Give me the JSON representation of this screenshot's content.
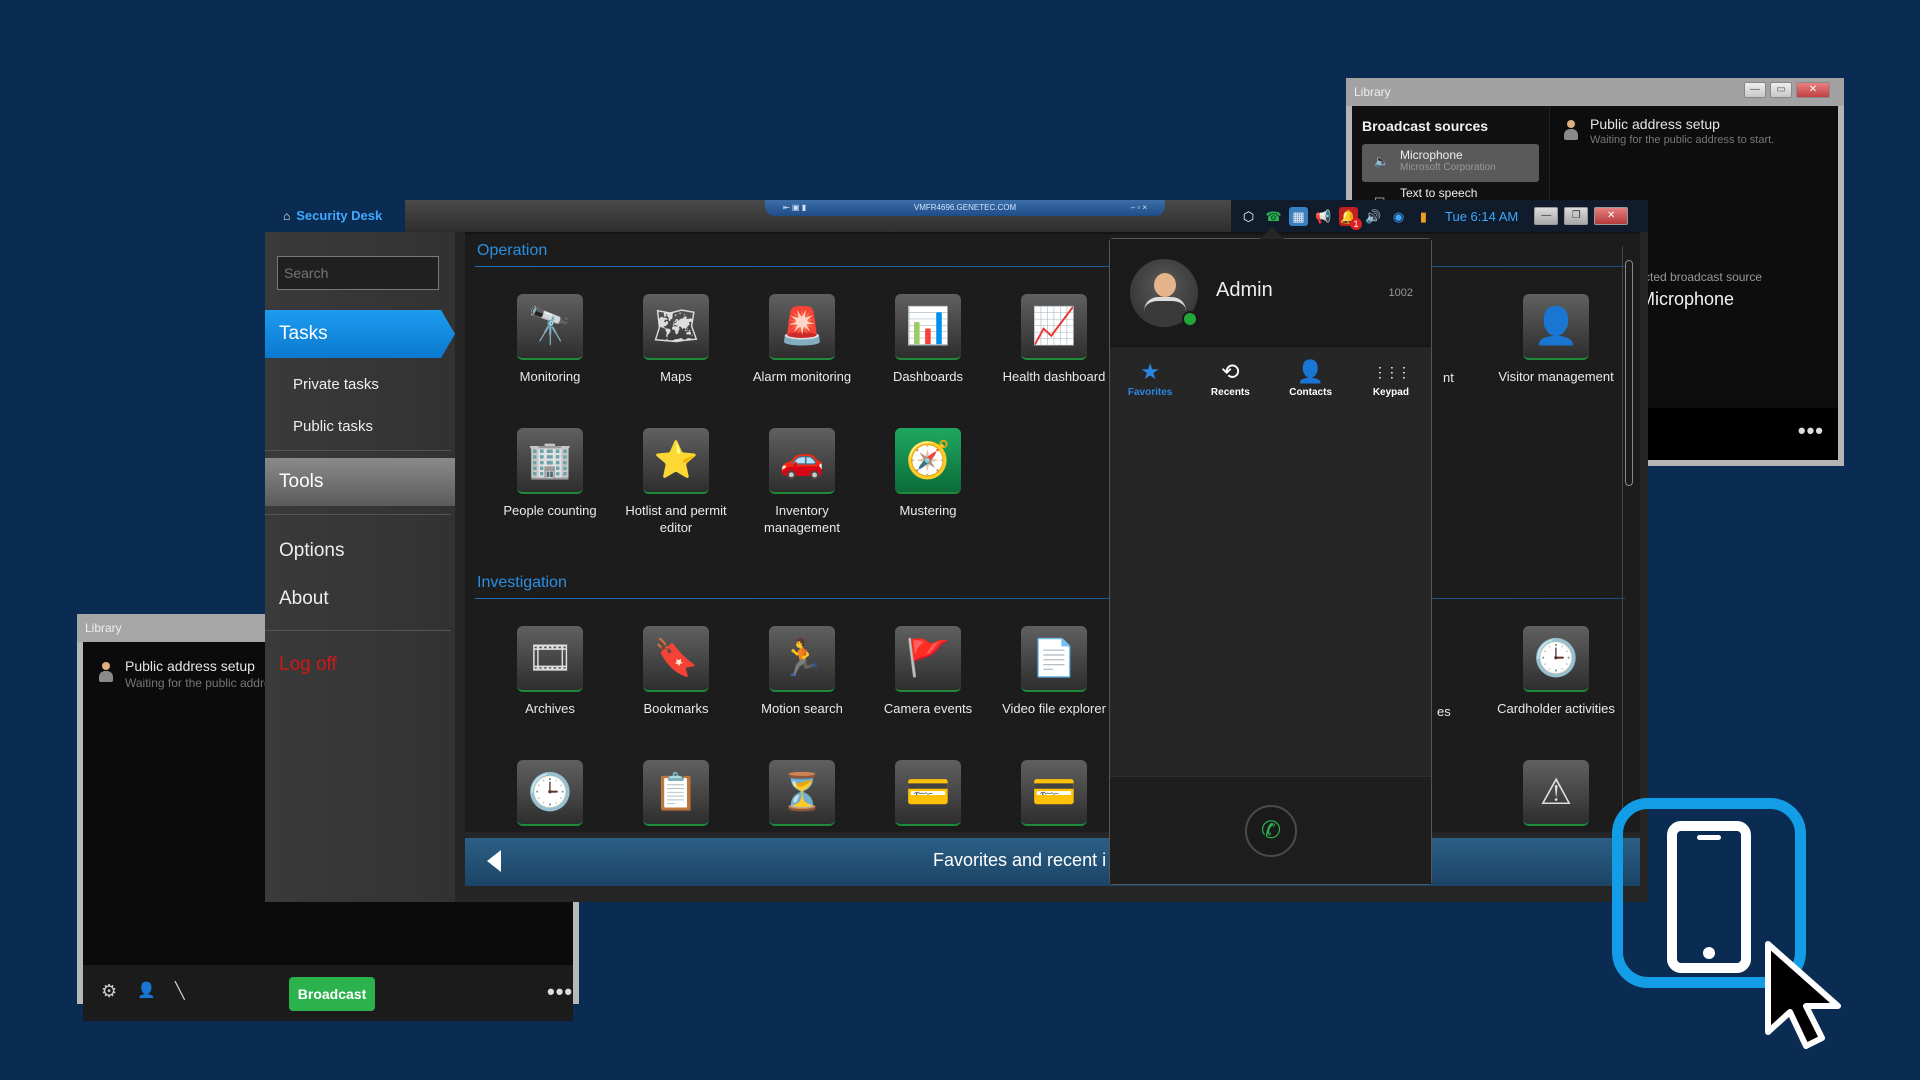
{
  "lib_left": {
    "title": "Library",
    "pa_title": "Public address setup",
    "pa_status": "Waiting for the public address to start.",
    "broadcast_label": "Broadcast",
    "more": "•••"
  },
  "lib_right": {
    "title": "Library",
    "sources_header": "Broadcast sources",
    "sources": [
      {
        "name": "Microphone",
        "desc": "Microsoft Corporation",
        "selected": true
      },
      {
        "name": "Text to speech",
        "desc": "",
        "selected": false
      }
    ],
    "pa_title": "Public address setup",
    "pa_status": "Waiting for the public address to start.",
    "selected_label": "Selected broadcast source",
    "selected_value": "Microphone",
    "more": "•••"
  },
  "security_desk": {
    "app_title": "Security Desk",
    "host": "VMFR4696.GENETEC.COM",
    "tray_time": "Tue 6:14 AM",
    "alarm_badge": "1",
    "search_placeholder": "Search",
    "nav": {
      "tasks": "Tasks",
      "private_tasks": "Private tasks",
      "public_tasks": "Public tasks",
      "tools": "Tools",
      "options": "Options",
      "about": "About",
      "log_off": "Log off"
    },
    "operation_header": "Operation",
    "investigation_header": "Investigation",
    "operation_tiles": [
      {
        "label": "Monitoring",
        "icon": "monitoring-icon",
        "glyph": "🔭"
      },
      {
        "label": "Maps",
        "icon": "maps-icon",
        "glyph": "🗺"
      },
      {
        "label": "Alarm monitoring",
        "icon": "alarm-monitoring-icon",
        "glyph": "🚨"
      },
      {
        "label": "Dashboards",
        "icon": "dashboards-icon",
        "glyph": "📊"
      },
      {
        "label": "Health dashboard",
        "icon": "health-dashboard-icon",
        "glyph": "📈"
      },
      {
        "label": "People counting",
        "icon": "people-counting-icon",
        "glyph": "🏢"
      },
      {
        "label": "Hotlist and permit editor",
        "icon": "hotlist-permit-icon",
        "glyph": "⭐"
      },
      {
        "label": "Inventory management",
        "icon": "inventory-management-icon",
        "glyph": "🚗"
      },
      {
        "label": "Mustering",
        "icon": "mustering-icon",
        "glyph": "🧭"
      }
    ],
    "right_tiles": [
      {
        "label": "Visitor management",
        "icon": "visitor-management-icon",
        "glyph": "👤"
      },
      {
        "label": "Cardholder activities",
        "icon": "cardholder-activities-icon",
        "glyph": "🕒"
      }
    ],
    "partial_labels": [
      "nt",
      "es"
    ],
    "investigation_tiles": [
      {
        "label": "Archives",
        "icon": "archives-icon",
        "glyph": "🎞"
      },
      {
        "label": "Bookmarks",
        "icon": "bookmarks-icon",
        "glyph": "🔖"
      },
      {
        "label": "Motion search",
        "icon": "motion-search-icon",
        "glyph": "🏃"
      },
      {
        "label": "Camera events",
        "icon": "camera-events-icon",
        "glyph": "🚩"
      },
      {
        "label": "Video file explorer",
        "icon": "video-file-explorer-icon",
        "glyph": "📄"
      }
    ],
    "row3_tiles": [
      {
        "icon": "door-activities-icon",
        "glyph": "🕒"
      },
      {
        "icon": "access-reports-icon",
        "glyph": "📋"
      },
      {
        "icon": "time-attendance-icon",
        "glyph": "⏳"
      },
      {
        "icon": "credential-activities-icon",
        "glyph": "💳"
      },
      {
        "icon": "credential-access-icon",
        "glyph": "💳"
      },
      {
        "icon": "plate-reads-icon",
        "glyph": "⚠"
      }
    ],
    "favorites_bar": "Favorites and recent i"
  },
  "phone_panel": {
    "user": "Admin",
    "extension": "1002",
    "tabs": [
      {
        "label": "Favorites",
        "icon": "star-icon",
        "glyph": "★",
        "active": true
      },
      {
        "label": "Recents",
        "icon": "history-icon",
        "glyph": "⟲",
        "active": false
      },
      {
        "label": "Contacts",
        "icon": "contact-icon",
        "glyph": "👤",
        "active": false
      },
      {
        "label": "Keypad",
        "icon": "keypad-icon",
        "glyph": "⋮⋮⋮",
        "active": false
      }
    ]
  },
  "colors": {
    "background": "#0b2c52",
    "accent": "#1c9cf0",
    "logoff": "#d11818",
    "broadcast": "#2bb24c",
    "mobile_icon": "#129de6"
  }
}
